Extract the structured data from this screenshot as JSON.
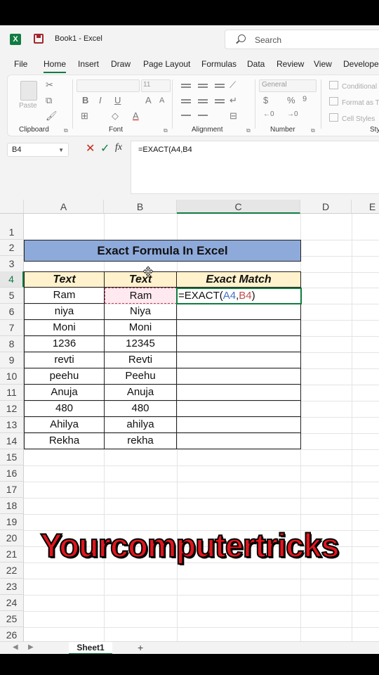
{
  "window": {
    "title": "Book1  -  Excel",
    "search_placeholder": "Search"
  },
  "menu": {
    "tabs": [
      {
        "label": "File"
      },
      {
        "label": "Home",
        "active": true
      },
      {
        "label": "Insert"
      },
      {
        "label": "Draw"
      },
      {
        "label": "Page Layout"
      },
      {
        "label": "Formulas"
      },
      {
        "label": "Data"
      },
      {
        "label": "Review"
      },
      {
        "label": "View"
      },
      {
        "label": "Develope"
      }
    ]
  },
  "ribbon": {
    "clipboard": {
      "label": "Clipboard",
      "paste": "Paste"
    },
    "font": {
      "label": "Font",
      "size": "11"
    },
    "alignment": {
      "label": "Alignment"
    },
    "number": {
      "label": "Number",
      "format": "General"
    },
    "styles": {
      "label": "Sty",
      "conditional": "Conditional",
      "format_as": "Format as T",
      "cell_styles": "Cell Styles"
    }
  },
  "formula_bar": {
    "name_box": "B4",
    "fx": "fx",
    "formula": "=EXACT(A4,B4"
  },
  "sheet": {
    "columns": [
      "A",
      "B",
      "C",
      "D",
      "E"
    ],
    "selected_column": "C",
    "rows": [
      "1",
      "2",
      "3",
      "4",
      "5",
      "6",
      "7",
      "8",
      "9",
      "10",
      "11",
      "12",
      "13",
      "14",
      "15",
      "16",
      "17",
      "18",
      "19",
      "20",
      "21",
      "22",
      "23",
      "24",
      "25",
      "26"
    ],
    "selected_row": "4",
    "title": "Exact Formula In Excel",
    "headers": [
      "Text",
      "Text",
      "Exact Match"
    ],
    "data": [
      [
        "Ram",
        "Ram"
      ],
      [
        "niya",
        "Niya"
      ],
      [
        "Moni",
        "Moni"
      ],
      [
        "1236",
        "12345"
      ],
      [
        "revti",
        "Revti"
      ],
      [
        "peehu",
        "Peehu"
      ],
      [
        "Anuja",
        "Anuja"
      ],
      [
        "480",
        "480"
      ],
      [
        "Ahilya",
        "ahilya"
      ],
      [
        "Rekha",
        "rekha"
      ]
    ],
    "editing_formula": {
      "prefix": "=EXACT(",
      "ref1": "A4",
      "comma": ",",
      "ref2": "B4",
      "suffix": ")"
    }
  },
  "sheet_tabs": {
    "tabs": [
      "Sheet1"
    ],
    "add": "+"
  },
  "watermark": "Yourcomputertricks",
  "colors": {
    "excel_green": "#107c41",
    "title_fill": "#8eaadb",
    "header_fill": "#fff2cc",
    "watermark": "#e0151d"
  }
}
